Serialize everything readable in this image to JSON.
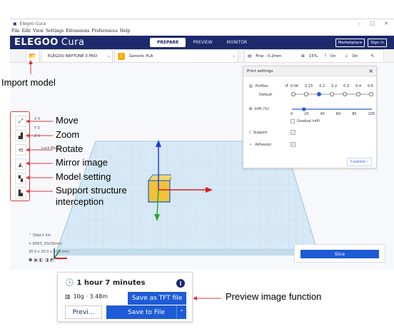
{
  "window": {
    "title": "Elegoo Cura",
    "controls": [
      "–",
      "□",
      "✕"
    ]
  },
  "menu": [
    "File",
    "Edit",
    "View",
    "Settings",
    "Extensions",
    "Preferences",
    "Help"
  ],
  "brand": {
    "logo": "ELEGOO",
    "app": "Cura"
  },
  "tabs": [
    "PREPARE",
    "PREVIEW",
    "MONITOR"
  ],
  "header_buttons": {
    "marketplace": "Marketplace",
    "signin": "Sign in"
  },
  "stage": {
    "printer": "ELEGOO NEPTUNE 3 PRO",
    "material": "Generic PLA",
    "summary": {
      "profile": "Fine - 0.2mm",
      "infill": "15%",
      "support": "On",
      "adhesion": "On"
    }
  },
  "print_settings": {
    "title": "Print settings",
    "profiles_label": "Profiles",
    "profile_default": "Default",
    "layer_values": [
      "0.06",
      "0.15",
      "0.2",
      "0.2",
      "0.3",
      "0.4",
      "0.6"
    ],
    "infill_label": "Infill (%)",
    "infill_ticks": [
      "0",
      "20",
      "40",
      "60",
      "80",
      "100"
    ],
    "infill_value_pct": 15,
    "gradual_infill": "Gradual infill",
    "support_label": "Support",
    "adhesion_label": "Adhesion",
    "custom_button": "Custom"
  },
  "tools": [
    "move",
    "scale",
    "rotate",
    "mirror",
    "per-model-settings",
    "support-blocker"
  ],
  "tool_inputs": [
    "X 0",
    "Y 0",
    "Z 0",
    "Lock Model"
  ],
  "object_info": {
    "object_list": "Object list",
    "model_name": "ENP3_30x30mm",
    "dims": "30.0 x 30.0 x 30.0 mm"
  },
  "annotations": {
    "import_model": "Import model",
    "move": "Move",
    "zoom": "Zoom",
    "rotate": "Rotate",
    "mirror": "Mirror image",
    "model_setting": "Model setting",
    "support_line1": "Support structure",
    "support_line2": "interception",
    "preview_fn": "Preview image function"
  },
  "bottom": {
    "time": "1 hour 7 minutes",
    "material": "10g · 3.48m",
    "tft_button": "Save as TFT file",
    "preview_button": "Previ...",
    "save_button": "Save to File"
  },
  "slice_button": "Slice",
  "colors": {
    "brand": "#1c2a6b",
    "accent": "#1e5bd6",
    "annotation_red": "#d83a3a",
    "model_yellow": "#f0c040"
  }
}
